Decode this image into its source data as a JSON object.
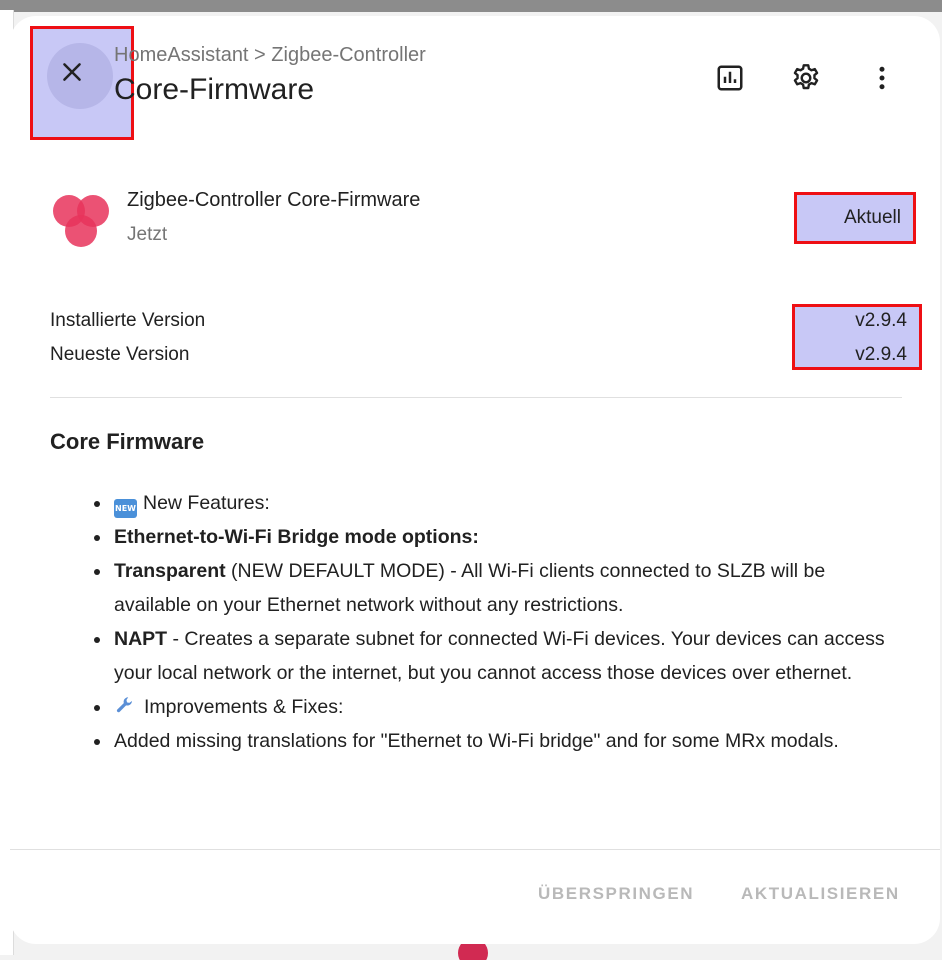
{
  "header": {
    "breadcrumb": "HomeAssistant > Zigbee-Controller",
    "title": "Core-Firmware",
    "icons": [
      "close-icon",
      "chart-icon",
      "gear-icon",
      "more-vertical-icon"
    ]
  },
  "entity": {
    "name": "Zigbee-Controller Core-Firmware",
    "time": "Jetzt",
    "state": "Aktuell",
    "icon": "firmware-logo-icon"
  },
  "versions": {
    "installed_label": "Installierte Version",
    "installed_value": "v2.9.4",
    "latest_label": "Neueste Version",
    "latest_value": "v2.9.4"
  },
  "release_notes": {
    "title": "Core Firmware",
    "items": {
      "new_features": "New Features:",
      "new_badge": "NEW",
      "bridge_modes": "Ethernet-to-Wi-Fi Bridge mode options:",
      "transparent_bold": "Transparent",
      "transparent_text": " (NEW DEFAULT MODE) - All Wi-Fi clients connected to SLZB will be available on your Ethernet network without any restrictions.",
      "napt_bold": "NAPT",
      "napt_text": " - Creates a separate subnet for connected Wi-Fi devices. Your devices can access your local network or the internet, but you cannot access those devices over ethernet.",
      "improvements": "Improvements & Fixes:",
      "translations": "Added missing translations for \"Ethernet to Wi-Fi bridge\" and for some MRx modals."
    }
  },
  "footer": {
    "skip_label": "ÜBERSPRINGEN",
    "update_label": "AKTUALISIEREN"
  },
  "colors": {
    "highlight_fill": "#c8c8f6",
    "highlight_border": "#ee0f14",
    "logo": "#e8345c",
    "disabled_text": "#b9b9b9"
  }
}
